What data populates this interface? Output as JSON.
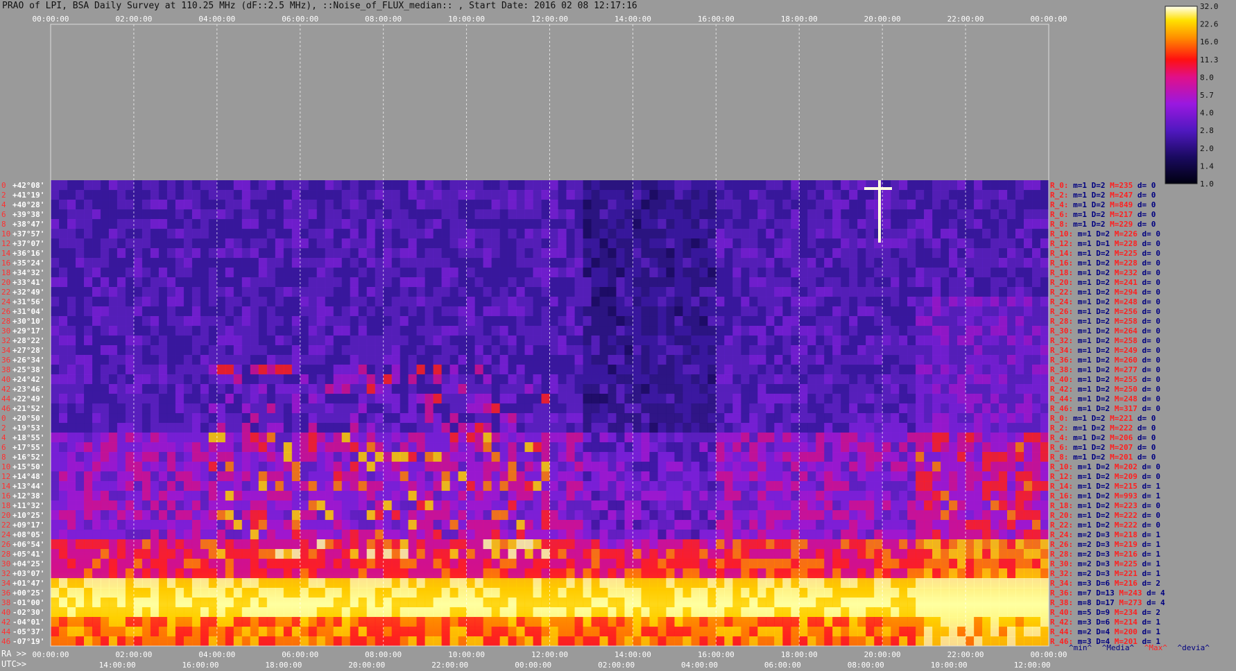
{
  "title": "PRAO of LPI, BSA Daily Survey at 110.25 MHz (dF::2.5 MHz), ::Noise_of_FLUX_median:: , Start Date: 2016 02 08 12:17:16",
  "colorbar": {
    "ticks": [
      "32.0",
      "22.6",
      "16.0",
      "11.3",
      "8.0",
      "5.7",
      "4.0",
      "2.8",
      "2.0",
      "1.4",
      "1.0"
    ]
  },
  "axes": {
    "top_time_labels": [
      "00:00:00",
      "02:00:00",
      "04:00:00",
      "06:00:00",
      "08:00:00",
      "10:00:00",
      "12:00:00",
      "14:00:00",
      "16:00:00",
      "18:00:00",
      "20:00:00",
      "22:00:00",
      "00:00:00"
    ],
    "ra_prefix": "RA >>",
    "ra_labels": [
      "00:00:00",
      "02:00:00",
      "04:00:00",
      "06:00:00",
      "08:00:00",
      "10:00:00",
      "12:00:00",
      "14:00:00",
      "16:00:00",
      "18:00:00",
      "20:00:00",
      "22:00:00",
      "00:00:00"
    ],
    "utc_prefix": "UTC>>",
    "utc_labels": [
      "14:00:00",
      "16:00:00",
      "18:00:00",
      "20:00:00",
      "22:00:00",
      "00:00:00",
      "02:00:00",
      "04:00:00",
      "06:00:00",
      "08:00:00",
      "10:00:00",
      "12:00:00"
    ]
  },
  "legend": {
    "min": "^min^",
    "median": "^Media^",
    "max": "^Max^",
    "dev": "^devia^"
  },
  "colors": {
    "min": "#000080",
    "median": "#000080",
    "max": "#ff2020",
    "dev": "#000080"
  },
  "chart_data": {
    "type": "heatmap",
    "title": "PRAO of LPI, BSA Daily Survey at 110.25 MHz (dF::2.5 MHz), ::Noise_of_FLUX_median:: , Start Date: 2016 02 08 12:17:16",
    "xlabel": "RA / UTC",
    "colorbar_range": [
      1.0,
      32.0
    ],
    "colorbar_scale": "log",
    "declinations": [
      "+42°08'",
      "+41°19'",
      "+40°28'",
      "+39°38'",
      "+38°47'",
      "+37°57'",
      "+37°07'",
      "+36°16'",
      "+35°24'",
      "+34°32'",
      "+33°41'",
      "+32°49'",
      "+31°56'",
      "+31°04'",
      "+30°10'",
      "+29°17'",
      "+28°22'",
      "+27°28'",
      "+26°34'",
      "+25°38'",
      "+24°42'",
      "+23°46'",
      "+22°49'",
      "+21°52'",
      "+20°50'",
      "+19°53'",
      "+18°55'",
      "+17°55'",
      "+16°52'",
      "+15°50'",
      "+14°48'",
      "+13°44'",
      "+12°38'",
      "+11°32'",
      "+10°25'",
      "+09°17'",
      "+08°05'",
      "+06°54'",
      "+05°41'",
      "+04°25'",
      "+03°07'",
      "+01°47'",
      "+00°25'",
      "-01°00'",
      "-02°30'",
      "-04°01'",
      "-05°37'",
      "-07°19'"
    ],
    "row_numbers": [
      "0",
      "2",
      "4",
      "6",
      "8",
      "10",
      "12",
      "14",
      "16",
      "18",
      "20",
      "22",
      "24",
      "26",
      "28",
      "30",
      "32",
      "34",
      "36",
      "38",
      "40",
      "42",
      "44",
      "46",
      "0",
      "2",
      "4",
      "6",
      "8",
      "10",
      "12",
      "14",
      "16",
      "18",
      "20",
      "22",
      "24",
      "26",
      "28",
      "30",
      "32",
      "34",
      "36",
      "38",
      "40",
      "42",
      "44",
      "46"
    ],
    "row_stats": [
      {
        "r": "R_0:",
        "m": "m=1",
        "D": "D=2",
        "M": "M=235",
        "d": "d= 0"
      },
      {
        "r": "R_2:",
        "m": "m=1",
        "D": "D=2",
        "M": "M=247",
        "d": "d= 0"
      },
      {
        "r": "R_4:",
        "m": "m=1",
        "D": "D=2",
        "M": "M=849",
        "d": "d= 0"
      },
      {
        "r": "R_6:",
        "m": "m=1",
        "D": "D=2",
        "M": "M=217",
        "d": "d= 0"
      },
      {
        "r": "R_8:",
        "m": "m=1",
        "D": "D=2",
        "M": "M=229",
        "d": "d= 0"
      },
      {
        "r": "R_10:",
        "m": "m=1",
        "D": "D=2",
        "M": "M=226",
        "d": "d= 0"
      },
      {
        "r": "R_12:",
        "m": "m=1",
        "D": "D=1",
        "M": "M=228",
        "d": "d= 0"
      },
      {
        "r": "R_14:",
        "m": "m=1",
        "D": "D=2",
        "M": "M=225",
        "d": "d= 0"
      },
      {
        "r": "R_16:",
        "m": "m=1",
        "D": "D=2",
        "M": "M=228",
        "d": "d= 0"
      },
      {
        "r": "R_18:",
        "m": "m=1",
        "D": "D=2",
        "M": "M=232",
        "d": "d= 0"
      },
      {
        "r": "R_20:",
        "m": "m=1",
        "D": "D=2",
        "M": "M=241",
        "d": "d= 0"
      },
      {
        "r": "R_22:",
        "m": "m=1",
        "D": "D=2",
        "M": "M=294",
        "d": "d= 0"
      },
      {
        "r": "R_24:",
        "m": "m=1",
        "D": "D=2",
        "M": "M=248",
        "d": "d= 0"
      },
      {
        "r": "R_26:",
        "m": "m=1",
        "D": "D=2",
        "M": "M=256",
        "d": "d= 0"
      },
      {
        "r": "R_28:",
        "m": "m=1",
        "D": "D=2",
        "M": "M=258",
        "d": "d= 0"
      },
      {
        "r": "R_30:",
        "m": "m=1",
        "D": "D=2",
        "M": "M=264",
        "d": "d= 0"
      },
      {
        "r": "R_32:",
        "m": "m=1",
        "D": "D=2",
        "M": "M=258",
        "d": "d= 0"
      },
      {
        "r": "R_34:",
        "m": "m=1",
        "D": "D=2",
        "M": "M=249",
        "d": "d= 0"
      },
      {
        "r": "R_36:",
        "m": "m=1",
        "D": "D=2",
        "M": "M=260",
        "d": "d= 0"
      },
      {
        "r": "R_38:",
        "m": "m=1",
        "D": "D=2",
        "M": "M=277",
        "d": "d= 0"
      },
      {
        "r": "R_40:",
        "m": "m=1",
        "D": "D=2",
        "M": "M=255",
        "d": "d= 0"
      },
      {
        "r": "R_42:",
        "m": "m=1",
        "D": "D=2",
        "M": "M=250",
        "d": "d= 0"
      },
      {
        "r": "R_44:",
        "m": "m=1",
        "D": "D=2",
        "M": "M=248",
        "d": "d= 0"
      },
      {
        "r": "R_46:",
        "m": "m=1",
        "D": "D=2",
        "M": "M=317",
        "d": "d= 0"
      },
      {
        "r": "R_0:",
        "m": "m=1",
        "D": "D=2",
        "M": "M=221",
        "d": "d= 0"
      },
      {
        "r": "R_2:",
        "m": "m=1",
        "D": "D=2",
        "M": "M=222",
        "d": "d= 0"
      },
      {
        "r": "R_4:",
        "m": "m=1",
        "D": "D=2",
        "M": "M=206",
        "d": "d= 0"
      },
      {
        "r": "R_6:",
        "m": "m=1",
        "D": "D=2",
        "M": "M=207",
        "d": "d= 0"
      },
      {
        "r": "R_8:",
        "m": "m=1",
        "D": "D=2",
        "M": "M=201",
        "d": "d= 0"
      },
      {
        "r": "R_10:",
        "m": "m=1",
        "D": "D=2",
        "M": "M=202",
        "d": "d= 0"
      },
      {
        "r": "R_12:",
        "m": "m=1",
        "D": "D=2",
        "M": "M=209",
        "d": "d= 0"
      },
      {
        "r": "R_14:",
        "m": "m=1",
        "D": "D=2",
        "M": "M=215",
        "d": "d= 1"
      },
      {
        "r": "R_16:",
        "m": "m=1",
        "D": "D=2",
        "M": "M=993",
        "d": "d= 1"
      },
      {
        "r": "R_18:",
        "m": "m=1",
        "D": "D=2",
        "M": "M=223",
        "d": "d= 0"
      },
      {
        "r": "R_20:",
        "m": "m=1",
        "D": "D=2",
        "M": "M=222",
        "d": "d= 0"
      },
      {
        "r": "R_22:",
        "m": "m=1",
        "D": "D=2",
        "M": "M=222",
        "d": "d= 0"
      },
      {
        "r": "R_24:",
        "m": "m=2",
        "D": "D=3",
        "M": "M=218",
        "d": "d= 1"
      },
      {
        "r": "R_26:",
        "m": "m=2",
        "D": "D=3",
        "M": "M=219",
        "d": "d= 1"
      },
      {
        "r": "R_28:",
        "m": "m=2",
        "D": "D=3",
        "M": "M=216",
        "d": "d= 1"
      },
      {
        "r": "R_30:",
        "m": "m=2",
        "D": "D=3",
        "M": "M=225",
        "d": "d= 1"
      },
      {
        "r": "R_32:",
        "m": "m=2",
        "D": "D=3",
        "M": "M=221",
        "d": "d= 1"
      },
      {
        "r": "R_34:",
        "m": "m=3",
        "D": "D=6",
        "M": "M=216",
        "d": "d= 2"
      },
      {
        "r": "R_36:",
        "m": "m=7",
        "D": "D=13",
        "M": "M=243",
        "d": "d= 4"
      },
      {
        "r": "R_38:",
        "m": "m=8",
        "D": "D=17",
        "M": "M=273",
        "d": "d= 4"
      },
      {
        "r": "R_40:",
        "m": "m=5",
        "D": "D=9",
        "M": "M=234",
        "d": "d= 2"
      },
      {
        "r": "R_42:",
        "m": "m=3",
        "D": "D=6",
        "M": "M=214",
        "d": "d= 1"
      },
      {
        "r": "R_44:",
        "m": "m=2",
        "D": "D=4",
        "M": "M=200",
        "d": "d= 1"
      },
      {
        "r": "R_46:",
        "m": "m=3",
        "D": "D=4",
        "M": "M=201",
        "d": "d= 1"
      }
    ]
  }
}
